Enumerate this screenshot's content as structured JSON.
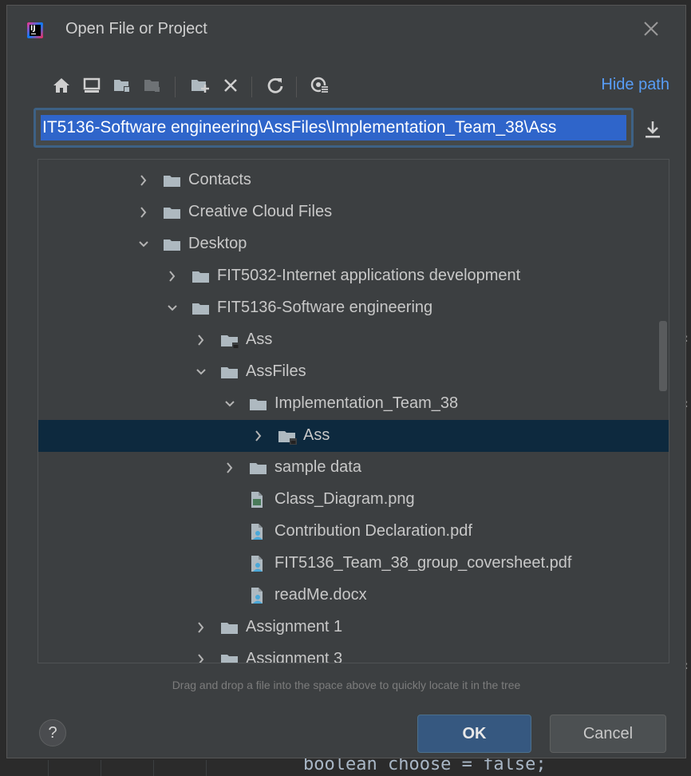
{
  "dialog": {
    "title": "Open File or Project",
    "hide_path_label": "Hide path",
    "path_value": "IT5136-Software engineering\\AssFiles\\Implementation_Team_38\\Ass",
    "hint": "Drag and drop a file into the space above to quickly locate it in the tree",
    "ok_label": "OK",
    "cancel_label": "Cancel",
    "help_label": "?"
  },
  "toolbar": {
    "icons": [
      "home-icon",
      "desktop-icon",
      "project-folder-icon",
      "module-folder-icon",
      "new-folder-icon",
      "delete-icon",
      "refresh-icon",
      "show-hidden-icon"
    ]
  },
  "tree": {
    "rows": [
      {
        "label": "Contacts",
        "type": "folder",
        "depth": 0,
        "expanded": false
      },
      {
        "label": "Creative Cloud Files",
        "type": "folder",
        "depth": 0,
        "expanded": false
      },
      {
        "label": "Desktop",
        "type": "folder",
        "depth": 0,
        "expanded": true
      },
      {
        "label": "FIT5032-Internet applications development",
        "type": "folder",
        "depth": 1,
        "expanded": false
      },
      {
        "label": "FIT5136-Software engineering",
        "type": "folder",
        "depth": 1,
        "expanded": true
      },
      {
        "label": "Ass",
        "type": "project-folder",
        "depth": 2,
        "expanded": false
      },
      {
        "label": "AssFiles",
        "type": "folder",
        "depth": 2,
        "expanded": true
      },
      {
        "label": "Implementation_Team_38",
        "type": "folder",
        "depth": 3,
        "expanded": true
      },
      {
        "label": "Ass",
        "type": "project-folder",
        "depth": 4,
        "expanded": false,
        "selected": true
      },
      {
        "label": "sample data",
        "type": "folder",
        "depth": 3,
        "expanded": false
      },
      {
        "label": "Class_Diagram.png",
        "type": "image-file",
        "depth": 3
      },
      {
        "label": "Contribution Declaration.pdf",
        "type": "pdf-file",
        "depth": 3
      },
      {
        "label": "FIT5136_Team_38_group_coversheet.pdf",
        "type": "pdf-file",
        "depth": 3
      },
      {
        "label": "readMe.docx",
        "type": "doc-file",
        "depth": 3
      },
      {
        "label": "Assignment 1",
        "type": "folder",
        "depth": 2,
        "expanded": false
      },
      {
        "label": "Assignment 3",
        "type": "folder",
        "depth": 2,
        "expanded": false
      }
    ]
  },
  "background_code": {
    "text": "boolean choose = false;"
  },
  "colors": {
    "dialog_bg": "#3c3f41",
    "selection_bg": "#0d293e",
    "link": "#589df6",
    "path_highlight": "#2f65ca",
    "ok_button": "#365880"
  }
}
